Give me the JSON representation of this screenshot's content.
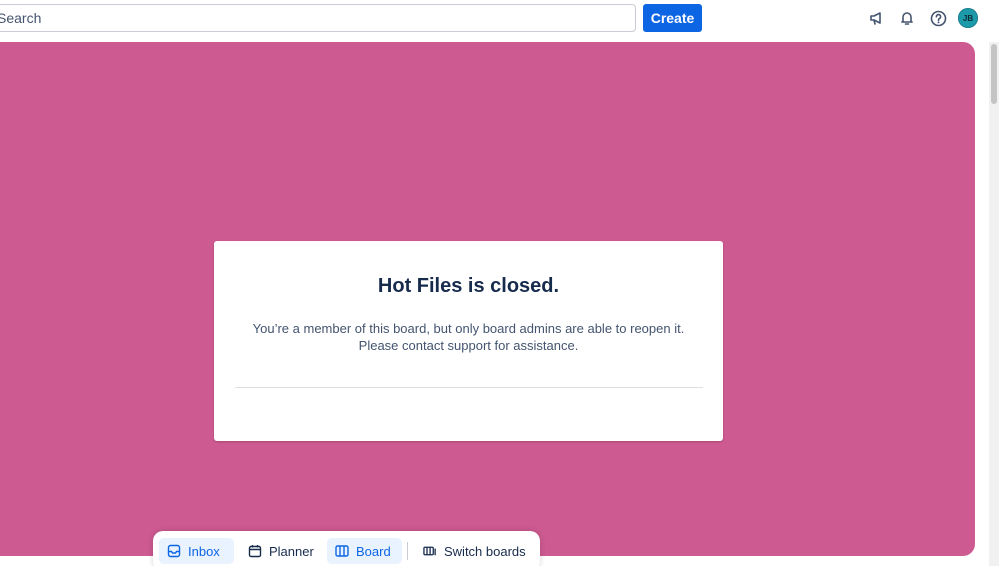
{
  "topbar": {
    "search_placeholder": "Search",
    "create_label": "Create",
    "avatar_initials": "JB"
  },
  "board": {
    "background_color": "#cd5a91",
    "notice_title": "Hot Files is closed.",
    "notice_message": "You’re a member of this board, but only board admins are able to reopen it. Please contact support for assistance."
  },
  "bottom_nav": {
    "items": [
      {
        "label": "Inbox",
        "icon": "inbox-icon",
        "active": true
      },
      {
        "label": "Planner",
        "icon": "calendar-icon",
        "active": false
      },
      {
        "label": "Board",
        "icon": "board-icon",
        "active": true
      },
      {
        "label": "Switch boards",
        "icon": "switch-boards-icon",
        "active": false
      }
    ]
  },
  "colors": {
    "accent": "#0c66e4",
    "avatar_bg": "#1d9aaa"
  }
}
